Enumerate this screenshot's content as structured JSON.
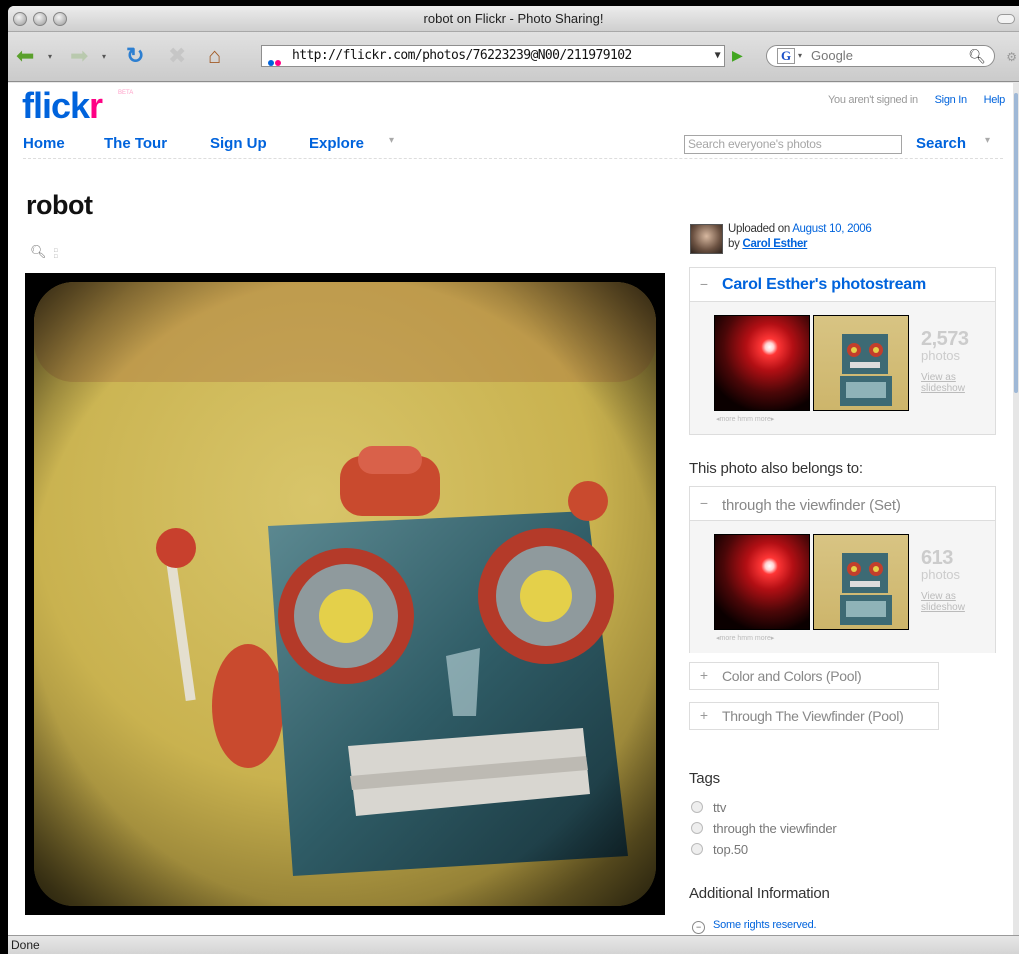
{
  "window": {
    "title": "robot on Flickr - Photo Sharing!"
  },
  "browser": {
    "url": "http://flickr.com/photos/76223239@N00/211979102",
    "search_placeholder": "Google",
    "search_engine_badge": "G",
    "status": "Done"
  },
  "site": {
    "logo_text_main": "flick",
    "logo_text_accent": "r",
    "logo_beta": "BETA",
    "signin_status": "You aren't signed in",
    "signin_link": "Sign In",
    "help_link": "Help",
    "nav": [
      "Home",
      "The Tour",
      "Sign Up",
      "Explore"
    ],
    "search_placeholder": "Search everyone's photos",
    "search_button": "Search"
  },
  "photo": {
    "title": "robot"
  },
  "sidebar": {
    "uploaded_prefix": "Uploaded on",
    "uploaded_date": "August 10, 2006",
    "by_prefix": "by",
    "owner": "Carol Esther",
    "photostream": {
      "title": "Carol Esther's photostream",
      "count": "2,573",
      "count_label": "photos",
      "slideshow_l1": "View as",
      "slideshow_l2": "slideshow",
      "nav": "◂more      hmm      more▸"
    },
    "belongs_heading": "This photo also belongs to:",
    "set": {
      "title": "through the viewfinder (Set)",
      "count": "613",
      "count_label": "photos",
      "slideshow_l1": "View as",
      "slideshow_l2": "slideshow",
      "nav": "◂more      hmm      more▸"
    },
    "pools": [
      "Color and Colors (Pool)",
      "Through The Viewfinder (Pool)"
    ],
    "tags_heading": "Tags",
    "tags": [
      "ttv",
      "through the viewfinder",
      "top.50"
    ],
    "additional_heading": "Additional Information",
    "rights": "Some rights reserved."
  }
}
